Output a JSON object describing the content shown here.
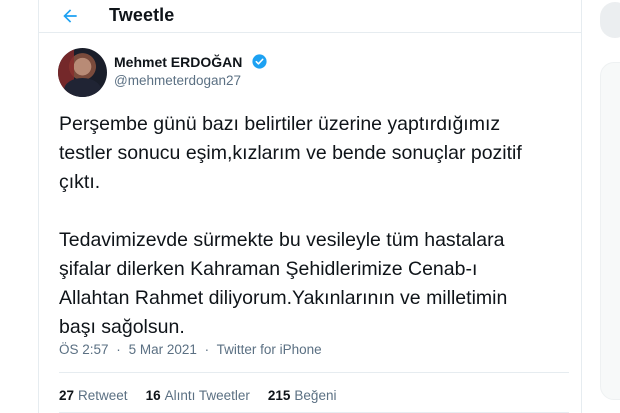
{
  "header": {
    "title": "Tweetle"
  },
  "author": {
    "name": "Mehmet ERDOĞAN",
    "handle": "@mehmeterdogan27",
    "verified": true
  },
  "tweet": {
    "text": "Perşembe günü bazı belirtiler üzerine yaptırdığımız\ntestler sonucu eşim,kızlarım ve bende sonuçlar pozitif\nçıktı.\n\nTedavimizevde sürmekte bu vesileyle tüm hastalara\nşifalar dilerken Kahraman Şehidlerimize Cenab-ı\nAllahtan Rahmet diliyorum.Yakınlarının ve milletimin\nbaşı sağolsun.",
    "time": "ÖS 2:57",
    "separator": "·",
    "date": "5 Mar 2021",
    "source": "Twitter for iPhone"
  },
  "stats": {
    "retweets": {
      "count": "27",
      "label": "Retweet"
    },
    "quotes": {
      "count": "16",
      "label": "Alıntı Tweetler"
    },
    "likes": {
      "count": "215",
      "label": "Beğeni"
    }
  },
  "colors": {
    "accent": "#1da1f2",
    "text": "#0f1419",
    "secondary": "#5b7083"
  },
  "icons": {
    "back": "arrow-left-icon",
    "verified": "verified-badge-icon"
  }
}
